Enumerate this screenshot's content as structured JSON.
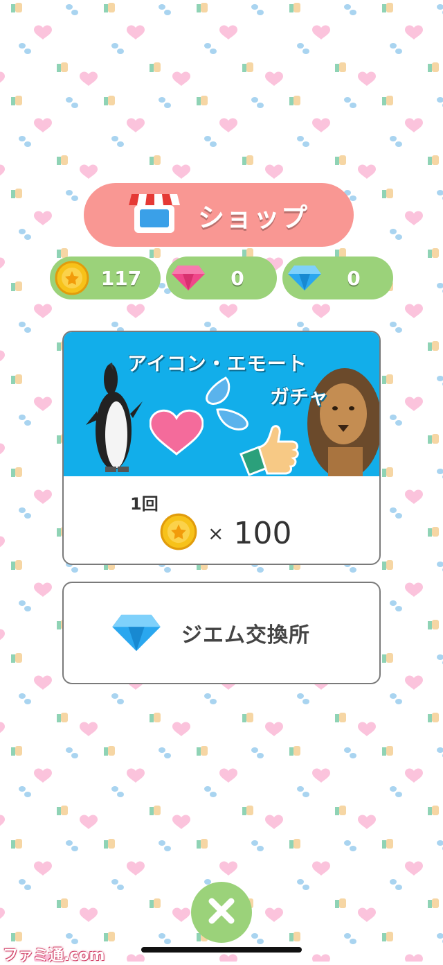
{
  "shop": {
    "title": "ショップ",
    "icon": "storefront-icon"
  },
  "currencies": [
    {
      "icon": "gold-coin-icon",
      "value": "117"
    },
    {
      "icon": "pink-gem-icon",
      "value": "0"
    },
    {
      "icon": "blue-gem-icon",
      "value": "0"
    }
  ],
  "gacha": {
    "title_line1": "アイコン・エモート",
    "title_line2": "ガチャ",
    "count_label": "1回",
    "cost_times": "×",
    "cost_amount": "100",
    "cost_icon": "gold-coin-icon"
  },
  "gem_exchange": {
    "label": "ジエム交換所",
    "icon": "blue-gem-icon"
  },
  "close": {
    "icon": "close-icon"
  },
  "watermark": {
    "text": "ファミ通.com"
  },
  "colors": {
    "shop_pink": "#f99793",
    "currency_green": "#9bd27a",
    "banner_blue": "#12aeea",
    "coin_gold": "#f7c21a",
    "gem_pink": "#f0468a",
    "gem_blue": "#2aa7ef"
  }
}
